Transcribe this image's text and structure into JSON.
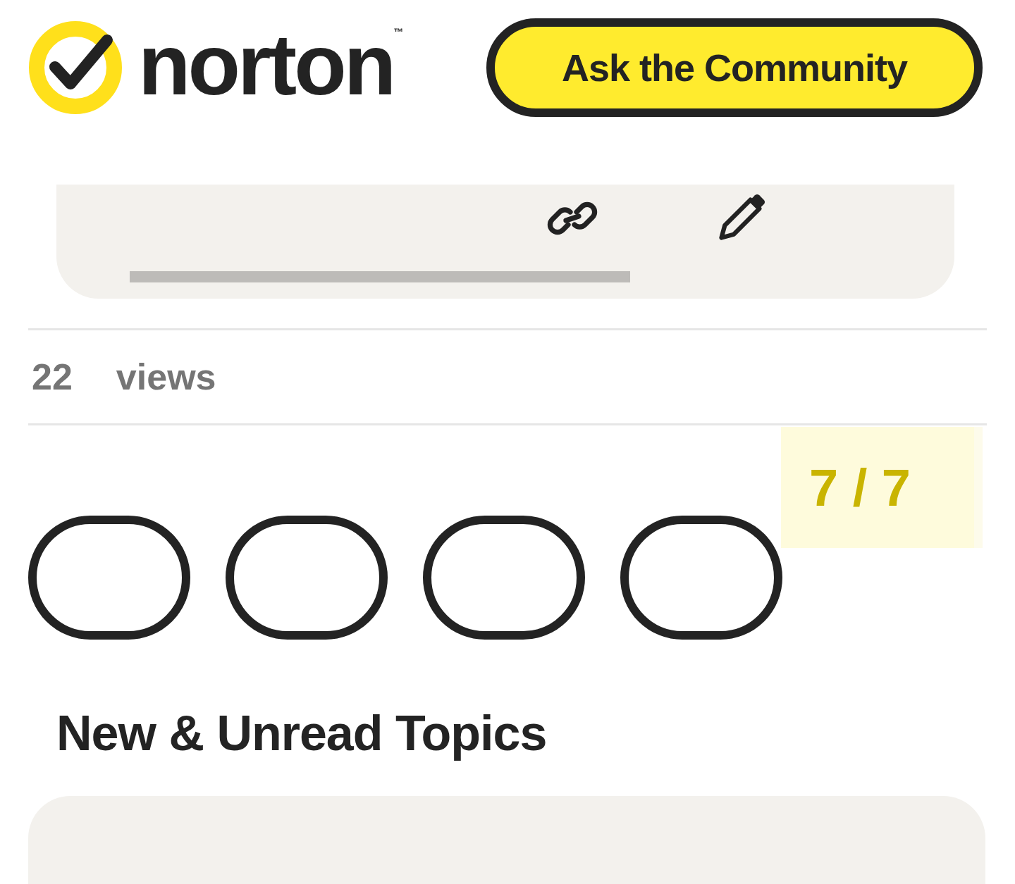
{
  "logo": {
    "wordmark": "norton",
    "trademark": "™"
  },
  "header_button": "Ask the Community",
  "stats": {
    "count": "22",
    "label": "views"
  },
  "pager": "7 / 7",
  "section_title": "New & Unread Topics"
}
